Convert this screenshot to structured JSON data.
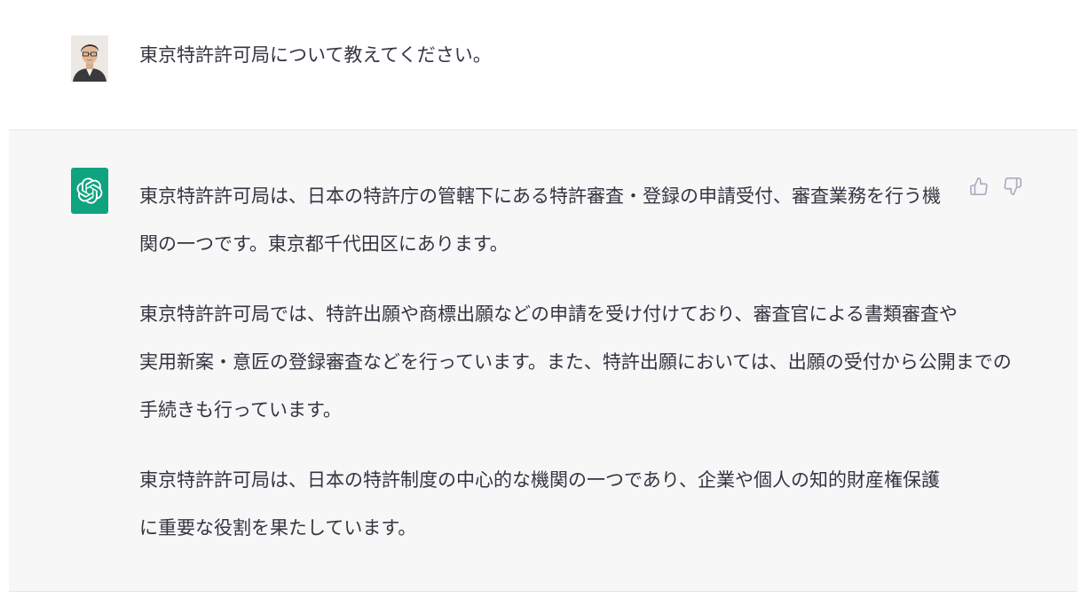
{
  "conversation": {
    "user_message": {
      "avatar_icon": "user-photo-avatar",
      "text": "東京特許許可局について教えてください。"
    },
    "assistant_message": {
      "avatar_icon": "openai-logo-icon",
      "avatar_color": "#10a37f",
      "paragraphs": [
        {
          "lines": [
            "東京特許許可局は、日本の特許庁の管轄下にある特許審査・登録の申請受付、審査業務を行う機",
            "関の一つです。東京都千代田区にあります。"
          ]
        },
        {
          "lines": [
            "東京特許許可局では、特許出願や商標出願などの申請を受け付けており、審査官による書類審査や",
            "実用新案・意匠の登録審査などを行っています。また、特許出願においては、出願の受付から公開までの",
            "手続きも行っています。"
          ]
        },
        {
          "lines": [
            "東京特許許可局は、日本の特許制度の中心的な機関の一つであり、企業や個人の知的財産権保護",
            "に重要な役割を果たしています。"
          ]
        }
      ],
      "feedback": {
        "thumbs_up_icon": "thumbs-up-icon",
        "thumbs_down_icon": "thumbs-down-icon"
      }
    }
  },
  "colors": {
    "assistant_background": "#f7f7f8",
    "text": "#343541",
    "icon_gray": "#acacbe"
  }
}
